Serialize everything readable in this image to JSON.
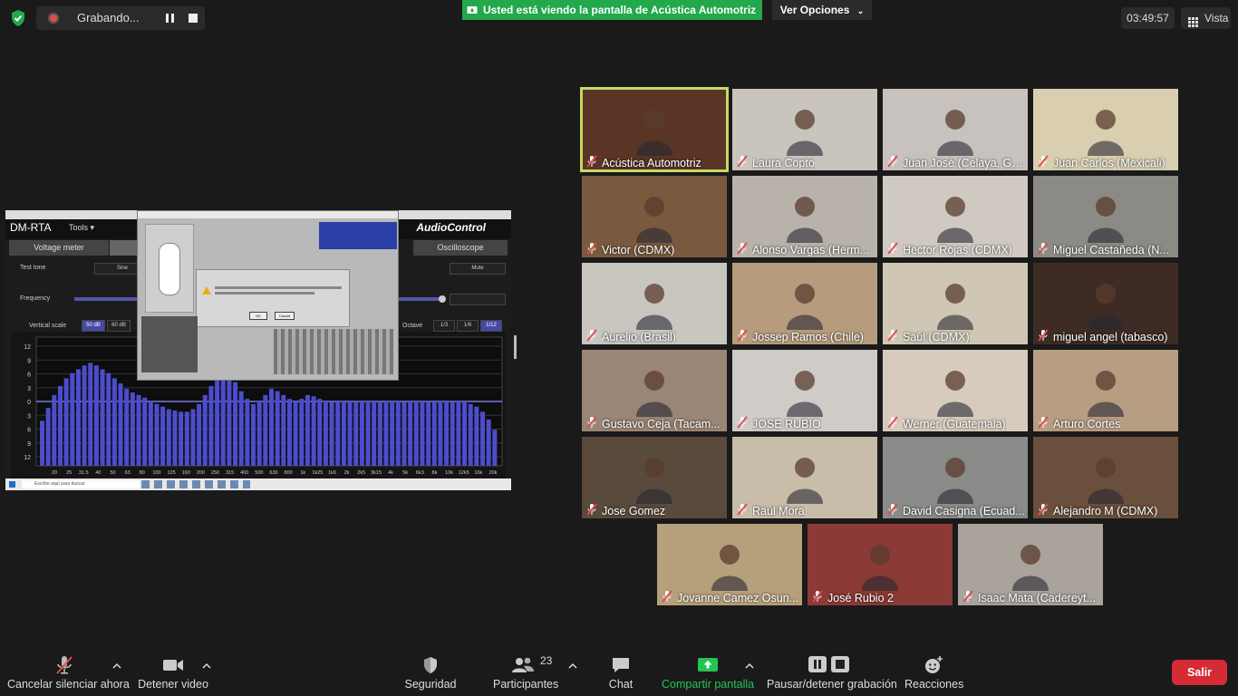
{
  "top_bar": {
    "recording_text": "Grabando...",
    "share_banner": "Usted está viendo la pantalla de Acústica Automotriz",
    "view_options": "Ver Opciones",
    "clock": "03:49:57",
    "view_label": "Vista"
  },
  "shared_screen": {
    "app_title": "DM-RTA",
    "tools_menu": "Tools",
    "brand": "AudioControl",
    "tabs": [
      "Voltage meter",
      "Oscilloscope"
    ],
    "test_tone_label": "Test tone",
    "tone_value": "Sine",
    "mute_label": "Mute",
    "frequency_label": "Frequency",
    "vertical_scale_label": "Vertical scale",
    "scale_50": "50 dB",
    "scale_60": "60 dB",
    "octave_label": "Octave",
    "octaves": [
      "1/3",
      "1/6",
      "1/12"
    ],
    "dialog_ok": "OK",
    "dialog_cancel": "Cancel",
    "taskbar_search": "Escribe aquí para buscar",
    "y_ticks": [
      "12",
      "9",
      "6",
      "3",
      "0",
      "3",
      "6",
      "9",
      "12"
    ],
    "x_ticks": [
      "20",
      "25",
      "31.5",
      "40",
      "50",
      "63",
      "80",
      "100",
      "125",
      "160",
      "200",
      "250",
      "315",
      "400",
      "500",
      "630",
      "800",
      "1k",
      "1k25",
      "1k6",
      "2k",
      "2k5",
      "3k15",
      "4k",
      "5k",
      "6k3",
      "8k",
      "10k",
      "12k5",
      "16k",
      "20k"
    ],
    "bar_levels": [
      0.35,
      0.45,
      0.55,
      0.62,
      0.68,
      0.72,
      0.75,
      0.78,
      0.8,
      0.78,
      0.75,
      0.72,
      0.68,
      0.64,
      0.6,
      0.57,
      0.55,
      0.53,
      0.5,
      0.48,
      0.46,
      0.44,
      0.43,
      0.42,
      0.42,
      0.44,
      0.48,
      0.55,
      0.62,
      0.68,
      0.72,
      0.7,
      0.65,
      0.58,
      0.52,
      0.48,
      0.5,
      0.55,
      0.6,
      0.58,
      0.55,
      0.52,
      0.5,
      0.52,
      0.55,
      0.54,
      0.52,
      0.5,
      0.5,
      0.5,
      0.5,
      0.5,
      0.5,
      0.5,
      0.5,
      0.5,
      0.5,
      0.5,
      0.5,
      0.5,
      0.5,
      0.5,
      0.5,
      0.5,
      0.5,
      0.5,
      0.5,
      0.5,
      0.5,
      0.5,
      0.5,
      0.48,
      0.46,
      0.42,
      0.36,
      0.28
    ]
  },
  "participants": [
    {
      "name": "Acústica Automotriz",
      "active": true,
      "bg": "#5a3526"
    },
    {
      "name": "Laura Copto",
      "bg": "#c9c4bd"
    },
    {
      "name": "Juan José (Celaya, Gto...",
      "bg": "#c7c2bd"
    },
    {
      "name": "Juan Carlos (Mexicali)",
      "bg": "#d9cfb0"
    },
    {
      "name": "Victor (CDMX)",
      "bg": "#7a5a3e"
    },
    {
      "name": "Alonso Vargas (Herm...",
      "bg": "#b8b2aa"
    },
    {
      "name": "Hector Rojas (CDMX)",
      "bg": "#cfc9c1"
    },
    {
      "name": "Miguel Castañeda (N...",
      "bg": "#8c8a84"
    },
    {
      "name": "Aurelio (Brasil)",
      "bg": "#c9c6c0"
    },
    {
      "name": "Jossep Ramos (Chile)",
      "bg": "#b69c7d"
    },
    {
      "name": "Saúl (CDMX)",
      "bg": "#cfc7b4"
    },
    {
      "name": "miguel angel (tabasco)",
      "bg": "#3e2c24"
    },
    {
      "name": "Gustavo Ceja (Tacam...",
      "bg": "#9a8676"
    },
    {
      "name": "JOSE RUBIO",
      "bg": "#cfcbc7"
    },
    {
      "name": "Werner (Guatemala)",
      "bg": "#d6cbbd"
    },
    {
      "name": "Arturo Cortes",
      "bg": "#b79d82"
    },
    {
      "name": "Jose Gomez",
      "bg": "#5a4a3c"
    },
    {
      "name": "Raúl Mora",
      "bg": "#c7bda9"
    },
    {
      "name": "David Casigna (Ecuad...",
      "bg": "#8a8a88"
    },
    {
      "name": "Alejandro M (CDMX)",
      "bg": "#6a4f3c"
    },
    {
      "name": "Jovanne Camez Osun...",
      "bg": "#b6a07c"
    },
    {
      "name": "José Rubio 2",
      "bg": "#8c3a35"
    },
    {
      "name": "Isaac Mata (Cadereyt...",
      "bg": "#a9a39c"
    }
  ],
  "toolbar": {
    "mute": "Cancelar silenciar ahora",
    "video": "Detener video",
    "security": "Seguridad",
    "participants": "Participantes",
    "participant_count": "23",
    "chat": "Chat",
    "share": "Compartir pantalla",
    "record": "Pausar/detener grabación",
    "reactions": "Reacciones",
    "leave": "Salir"
  },
  "colors": {
    "share_green": "#23a84b",
    "leave_red": "#d52b34",
    "active_speaker": "#c6d964",
    "rta_bars": "#4c4ccc"
  }
}
